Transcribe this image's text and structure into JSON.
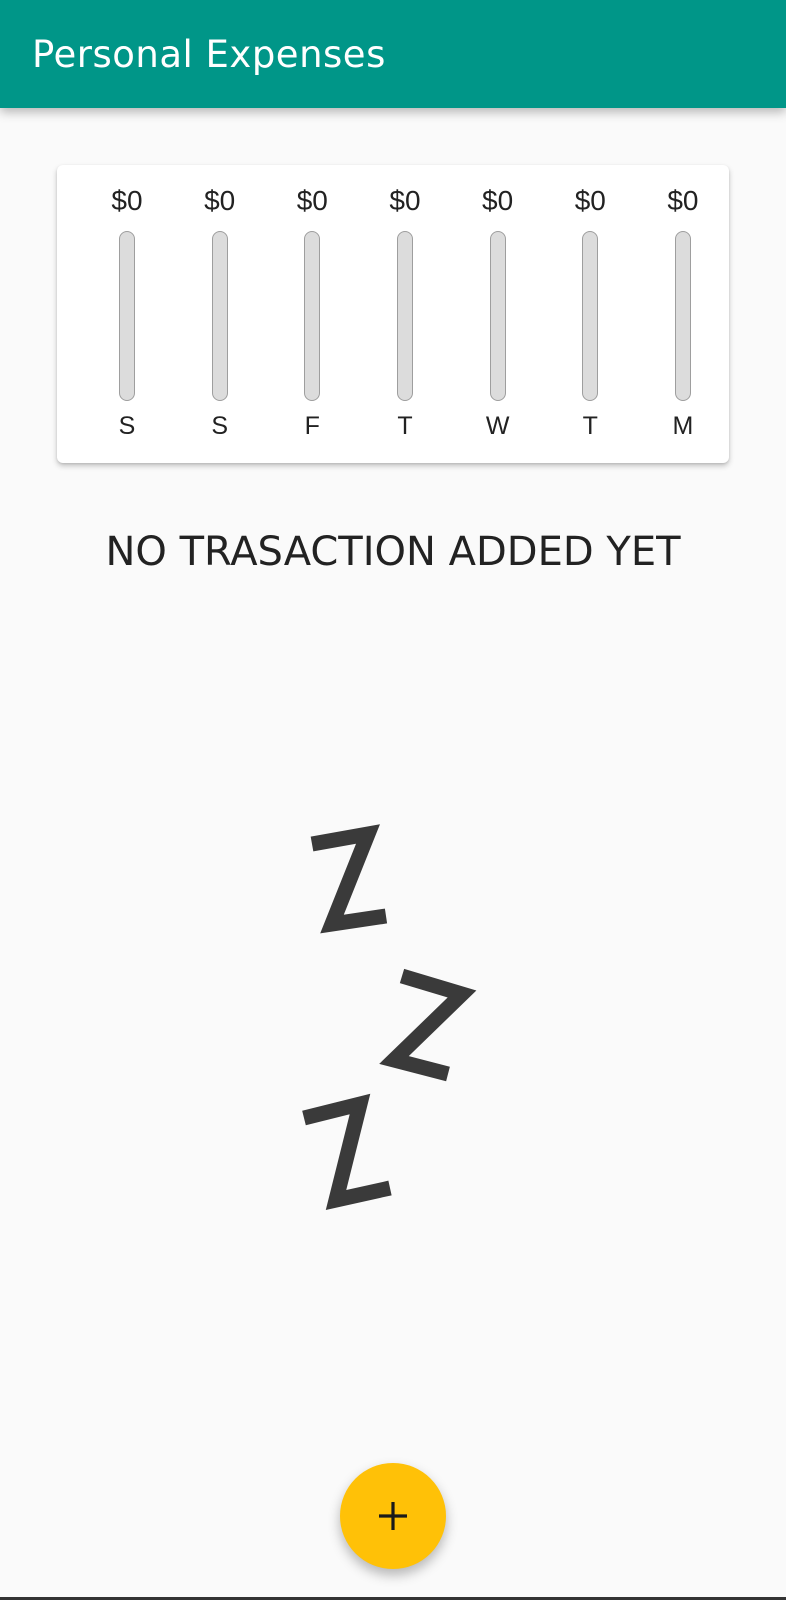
{
  "app_bar": {
    "title": "Personal Expenses",
    "color": "#009688"
  },
  "chart": {
    "bars": [
      {
        "amount": "$0",
        "day": "S",
        "fraction": 0
      },
      {
        "amount": "$0",
        "day": "S",
        "fraction": 0
      },
      {
        "amount": "$0",
        "day": "F",
        "fraction": 0
      },
      {
        "amount": "$0",
        "day": "T",
        "fraction": 0
      },
      {
        "amount": "$0",
        "day": "W",
        "fraction": 0
      },
      {
        "amount": "$0",
        "day": "T",
        "fraction": 0
      },
      {
        "amount": "$0",
        "day": "M",
        "fraction": 0
      }
    ]
  },
  "empty_state": {
    "message": "NO TRASACTION ADDED YET",
    "image_icon": "sleeping-zzz-icon"
  },
  "fab": {
    "icon": "plus-icon",
    "color": "#ffc107"
  }
}
